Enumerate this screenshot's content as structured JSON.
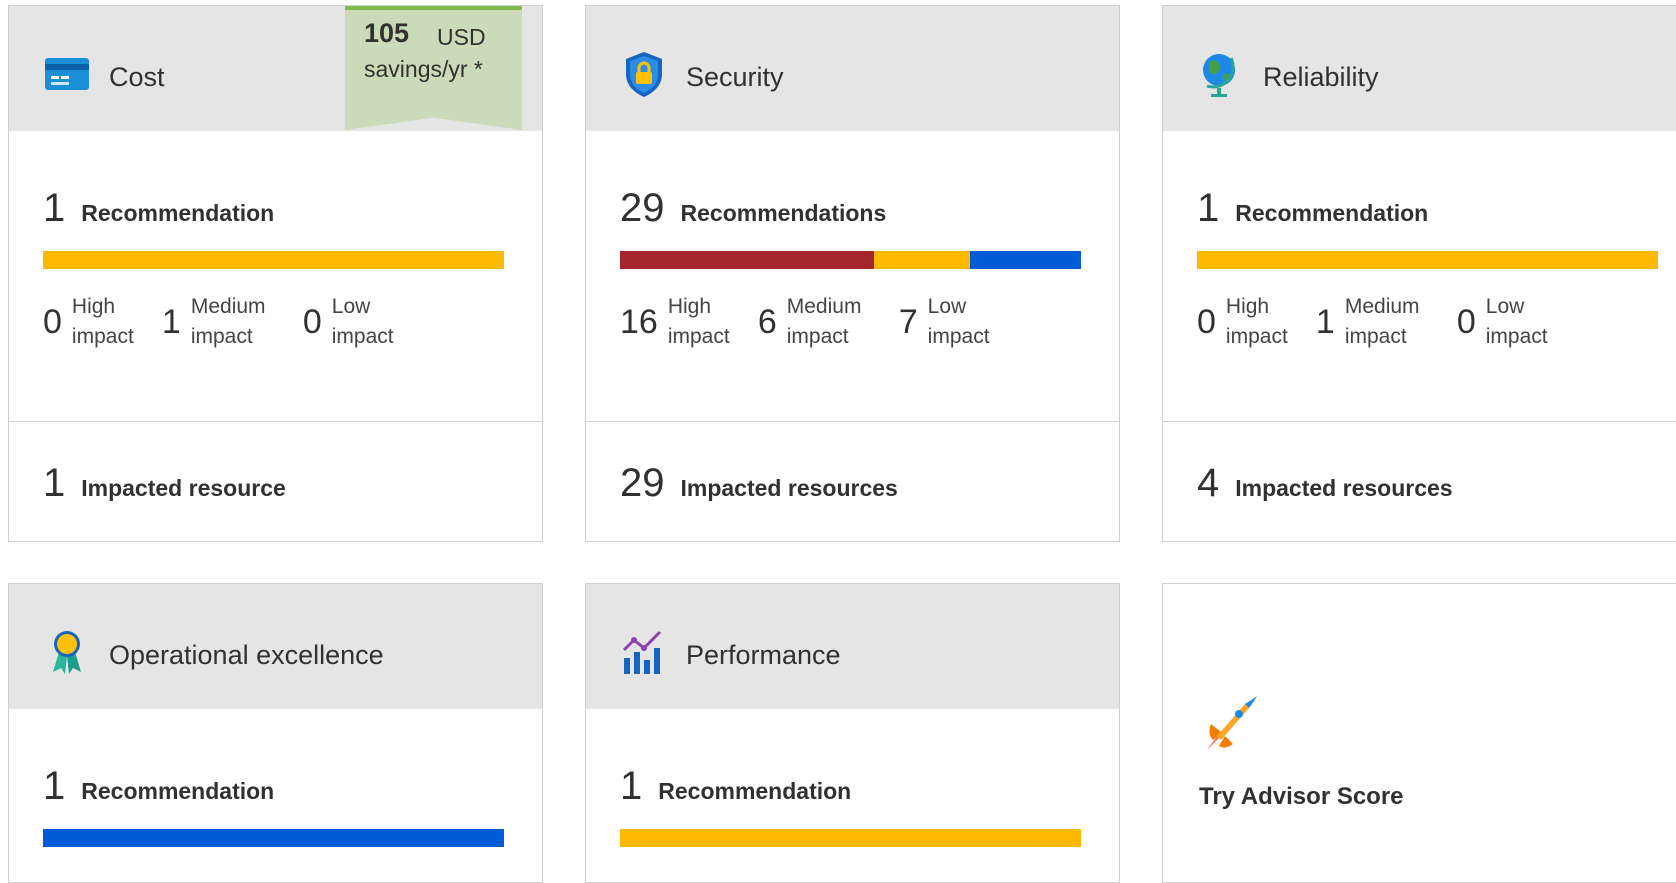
{
  "cards": {
    "cost": {
      "title": "Cost",
      "savings": {
        "amount": "105",
        "currency": "USD",
        "period": "savings/yr *"
      },
      "recommendations": {
        "count": "1",
        "label": "Recommendation"
      },
      "impact": {
        "high": 0,
        "medium": 1,
        "low": 0
      },
      "high_label": "High impact",
      "medium_label": "Medium impact",
      "low_label": "Low impact",
      "resources": {
        "count": "1",
        "label": "Impacted resource"
      }
    },
    "security": {
      "title": "Security",
      "recommendations": {
        "count": "29",
        "label": "Recommendations"
      },
      "impact": {
        "high": 16,
        "medium": 6,
        "low": 7
      },
      "high_label": "High impact",
      "medium_label": "Medium impact",
      "low_label": "Low impact",
      "resources": {
        "count": "29",
        "label": "Impacted resources"
      }
    },
    "reliability": {
      "title": "Reliability",
      "recommendations": {
        "count": "1",
        "label": "Recommendation"
      },
      "impact": {
        "high": 0,
        "medium": 1,
        "low": 0
      },
      "high_label": "High impact",
      "medium_label": "Medium impact",
      "low_label": "Low impact",
      "resources": {
        "count": "4",
        "label": "Impacted resources"
      }
    },
    "operational": {
      "title": "Operational excellence",
      "recommendations": {
        "count": "1",
        "label": "Recommendation"
      },
      "impact": {
        "high": 0,
        "medium": 0,
        "low": 1
      }
    },
    "performance": {
      "title": "Performance",
      "recommendations": {
        "count": "1",
        "label": "Recommendation"
      },
      "impact": {
        "high": 0,
        "medium": 1,
        "low": 0
      }
    },
    "advisor_score": {
      "label": "Try Advisor Score"
    }
  },
  "colors": {
    "high": "#a4262c",
    "medium": "#ffb900",
    "low": "#005bd6",
    "header_bg": "#e5e5e5",
    "savings_bg": "#c9dbb8"
  },
  "icons": {
    "cost": "credit-card-icon",
    "security": "shield-lock-icon",
    "reliability": "globe-icon",
    "operational": "award-ribbon-icon",
    "performance": "chart-icon",
    "advisor": "rocket-icon"
  }
}
